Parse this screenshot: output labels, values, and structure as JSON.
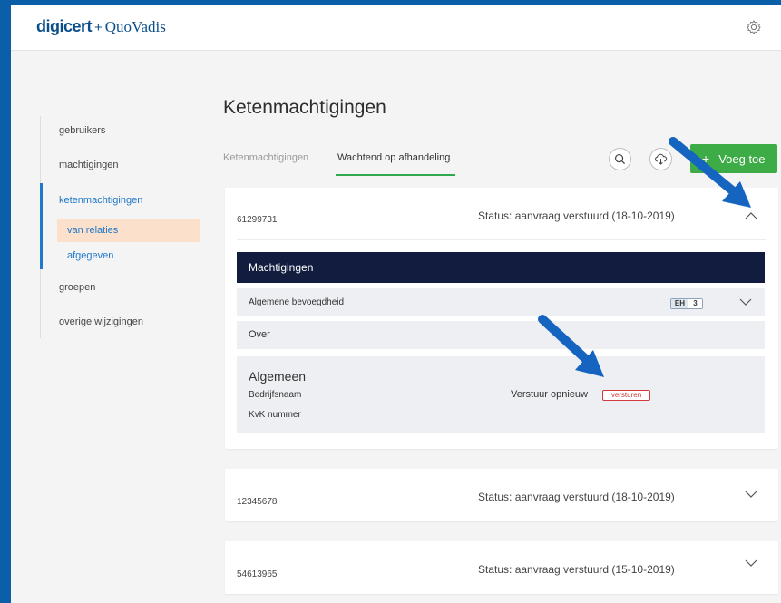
{
  "header": {
    "logo_primary": "digicert",
    "logo_sep": "+",
    "logo_secondary": "QuoVadis",
    "settings_icon": "gear-icon"
  },
  "sidebar": {
    "items": [
      {
        "label": "gebruikers"
      },
      {
        "label": "machtigingen"
      },
      {
        "label": "ketenmachtigingen",
        "active": true
      },
      {
        "label": "groepen"
      },
      {
        "label": "overige wijzigingen"
      }
    ],
    "subitems": [
      {
        "label": "van relaties",
        "selected": true
      },
      {
        "label": "afgegeven"
      }
    ]
  },
  "main": {
    "title": "Ketenmachtigingen",
    "tabs": [
      {
        "label": "Ketenmachtigingen"
      },
      {
        "label": "Wachtend op afhandeling",
        "active": true
      }
    ],
    "add_button": "Voeg toe",
    "add_plus": "+",
    "cards": [
      {
        "id": "61299731",
        "status": "Status: aanvraag verstuurd (18-10-2019)",
        "expanded": true,
        "section_title": "Machtigingen",
        "permission": "Algemene bevoegdheid",
        "badge_label": "EH",
        "badge_count": "3",
        "over_label": "Over",
        "general_title": "Algemeen",
        "company_label": "Bedrijfsnaam",
        "kvk_label": "KvK nummer",
        "resend_label": "Verstuur opnieuw",
        "resend_button": "versturen"
      },
      {
        "id": "12345678",
        "status": "Status: aanvraag verstuurd (18-10-2019)",
        "expanded": false
      },
      {
        "id": "54613965",
        "status": "Status: aanvraag verstuurd (15-10-2019)",
        "expanded": false
      }
    ]
  },
  "colors": {
    "frame": "#0b5fa8",
    "accent_green": "#3dac47",
    "active_blue": "#1f78c8",
    "selected_bg": "#fbe0cb",
    "navy": "#111c3e",
    "danger": "#d23b3b"
  }
}
